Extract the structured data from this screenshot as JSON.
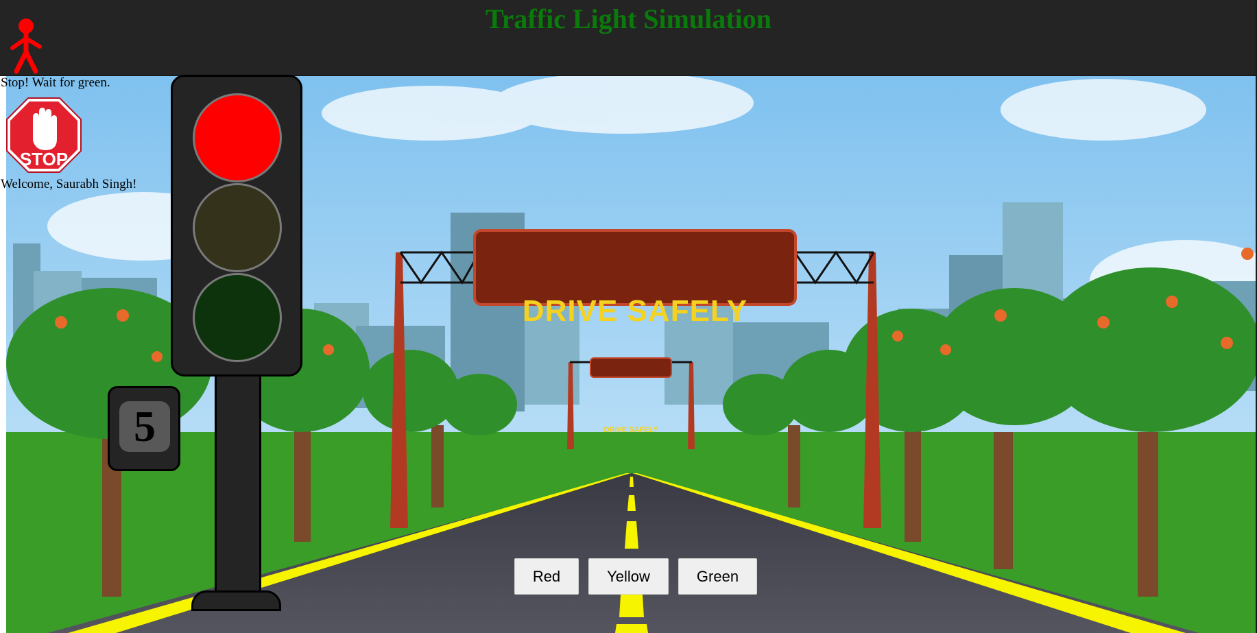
{
  "app": {
    "title": "Traffic Light Simulation"
  },
  "status": {
    "message": "Stop! Wait for green.",
    "sign_label": "STOP",
    "welcome": "Welcome, Saurabh Singh!"
  },
  "signal": {
    "active_light": "red",
    "countdown": "5",
    "lights": [
      {
        "name": "red",
        "on_color": "#ff0000",
        "off_color": "#3a0000",
        "on": true
      },
      {
        "name": "yellow",
        "on_color": "#ffff00",
        "off_color": "#35321c",
        "on": false
      },
      {
        "name": "green",
        "on_color": "#00cc00",
        "off_color": "#0d330c",
        "on": false
      }
    ]
  },
  "scene": {
    "banner_text": "DRIVE SAFELY",
    "banner_text_small": "DRIVE SAFELY"
  },
  "controls": {
    "red_label": "Red",
    "yellow_label": "Yellow",
    "green_label": "Green"
  },
  "colors": {
    "header_bg": "#242424",
    "title": "#0a7a0a",
    "pedestrian": "#ff0000",
    "banner": "#7a2410",
    "banner_text": "#f4d21f",
    "road_line": "#f7f400"
  },
  "icons": {
    "pedestrian": "red-walking-person-icon",
    "stop_sign": "stop-hand-sign-icon"
  }
}
